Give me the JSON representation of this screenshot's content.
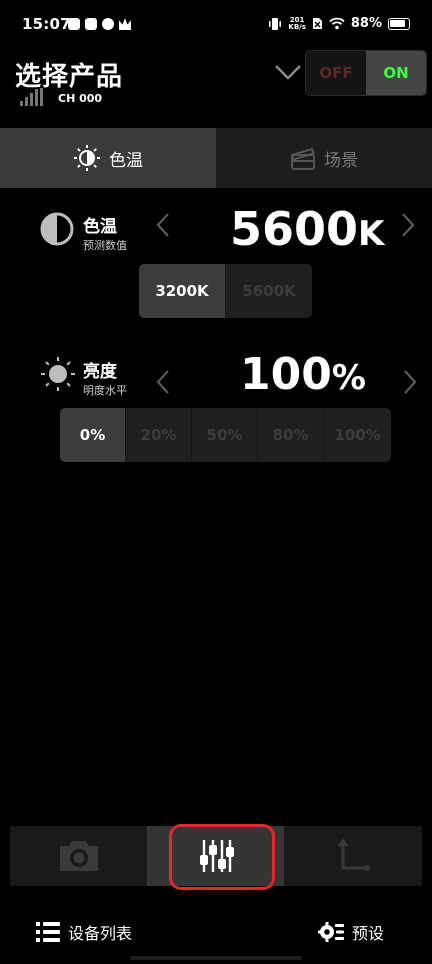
{
  "status_bar": {
    "time": "15:07",
    "net_speed_value": "201",
    "net_speed_unit": "KB/s",
    "battery": "88%"
  },
  "header": {
    "title": "选择产品",
    "channel": "CH 000",
    "power_off_label": "OFF",
    "power_on_label": "ON",
    "power_state": "ON"
  },
  "tabs": [
    {
      "label": "色温",
      "icon": "cct-sun-icon",
      "active": true
    },
    {
      "label": "场景",
      "icon": "clapperboard-icon",
      "active": false
    }
  ],
  "color_temp": {
    "name": "色温",
    "sub": "预测数值",
    "value": "5600",
    "unit": "K",
    "presets": [
      "3200K",
      "5600K"
    ],
    "selected_preset": "3200K"
  },
  "brightness": {
    "name": "亮度",
    "sub": "明度水平",
    "value": "100",
    "unit": "%",
    "presets": [
      "0%",
      "20%",
      "50%",
      "80%",
      "100%"
    ],
    "selected_preset": "0%"
  },
  "bottom_bar": {
    "items": [
      {
        "icon": "camera-icon",
        "active": false
      },
      {
        "icon": "sliders-icon",
        "active": true
      },
      {
        "icon": "axis-icon",
        "active": false
      }
    ]
  },
  "footer": {
    "device_list_label": "设备列表",
    "presets_label": "预设"
  },
  "colors": {
    "on_green": "#3dff3d",
    "off_dark_red": "#5a2828",
    "highlight_red": "#e0282e"
  }
}
